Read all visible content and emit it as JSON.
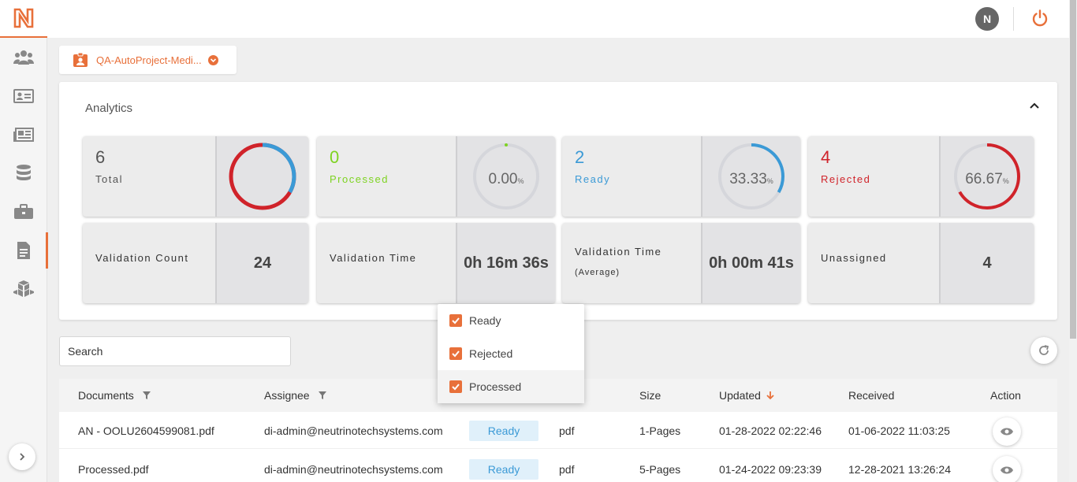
{
  "sidebar": {
    "items": [
      {
        "icon": "users-icon"
      },
      {
        "icon": "id-card-icon"
      },
      {
        "icon": "newspaper-icon"
      },
      {
        "icon": "database-icon"
      },
      {
        "icon": "briefcase-icon"
      },
      {
        "icon": "document-icon",
        "active": true
      },
      {
        "icon": "cubes-icon"
      }
    ]
  },
  "topbar": {
    "avatar_initial": "N"
  },
  "project": {
    "label": "QA-AutoProject-Medi..."
  },
  "analytics": {
    "title": "Analytics",
    "total": {
      "value": "6",
      "label": "Total"
    },
    "processed": {
      "value": "0",
      "label": "Processed",
      "percent": "0.00",
      "percent_unit": "%"
    },
    "ready": {
      "value": "2",
      "label": "Ready",
      "percent": "33.33",
      "percent_unit": "%"
    },
    "rejected": {
      "value": "4",
      "label": "Rejected",
      "percent": "66.67",
      "percent_unit": "%"
    },
    "validation_count": {
      "label": "Validation Count",
      "value": "24"
    },
    "validation_time": {
      "label": "Validation Time",
      "value": "0h 16m 36s"
    },
    "validation_time_avg": {
      "label": "Validation Time",
      "sublabel": "(Average)",
      "value": "0h 00m 41s"
    },
    "unassigned": {
      "label": "Unassigned",
      "value": "4"
    }
  },
  "colors": {
    "accent": "#e8703a",
    "processed": "#7ed321",
    "ready": "#3b9ad6",
    "rejected": "#d0232a"
  },
  "search": {
    "placeholder": "Search"
  },
  "table": {
    "headers": {
      "documents": "Documents",
      "assignee": "Assignee",
      "size": "Size",
      "updated": "Updated",
      "received": "Received",
      "action": "Action"
    },
    "rows": [
      {
        "document": "AN - OOLU2604599081.pdf",
        "assignee": "di-admin@neutrinotechsystems.com",
        "status": "Ready",
        "type": "pdf",
        "size": "1-Pages",
        "updated": "01-28-2022 02:22:46",
        "received": "01-06-2022 11:03:25"
      },
      {
        "document": "Processed.pdf",
        "assignee": "di-admin@neutrinotechsystems.com",
        "status": "Ready",
        "type": "pdf",
        "size": "5-Pages",
        "updated": "01-24-2022 09:23:39",
        "received": "12-28-2021 13:26:24"
      }
    ]
  },
  "status_filter": {
    "options": [
      {
        "label": "Ready",
        "checked": true
      },
      {
        "label": "Rejected",
        "checked": true
      },
      {
        "label": "Processed",
        "checked": true
      }
    ]
  }
}
